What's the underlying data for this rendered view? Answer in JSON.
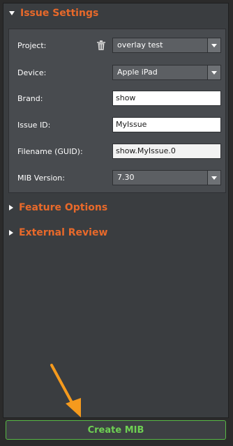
{
  "sections": {
    "issue_settings": "Issue Settings",
    "feature_options": "Feature Options",
    "external_review": "External Review"
  },
  "fields": {
    "project": {
      "label": "Project:",
      "value": "overlay test"
    },
    "device": {
      "label": "Device:",
      "value": "Apple iPad"
    },
    "brand": {
      "label": "Brand:",
      "value": "show"
    },
    "issue_id": {
      "label": "Issue ID:",
      "value": "MyIssue"
    },
    "filename": {
      "label": "Filename (GUID):",
      "value": "show.MyIssue.0"
    },
    "mib_version": {
      "label": "MIB Version:",
      "value": "7.30"
    }
  },
  "actions": {
    "create_label": "Create MIB"
  },
  "icons": {
    "delete": "trash-icon",
    "annotation": "arrow-icon"
  },
  "colors": {
    "accent_orange": "#e8692a",
    "button_green": "#6ed053",
    "annotation_arrow": "#f59a1d"
  }
}
